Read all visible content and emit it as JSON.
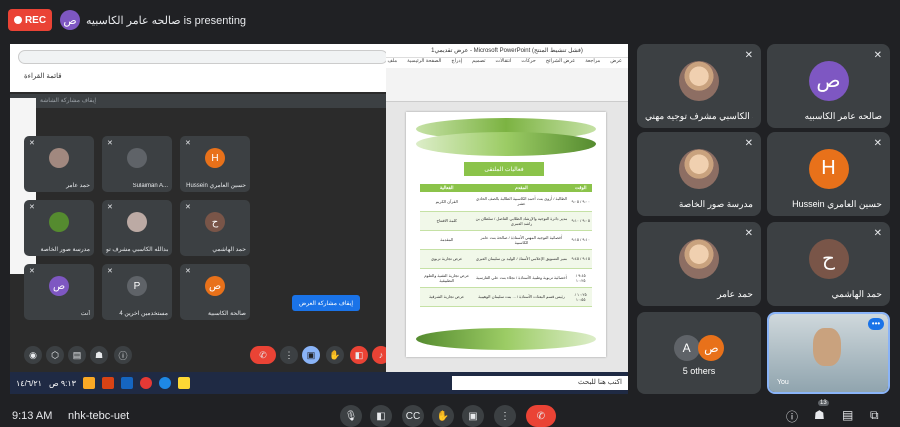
{
  "top": {
    "rec_label": "REC",
    "presenter_initial": "ص",
    "presenting_text": "صالحه عامر الكاسبيه is presenting"
  },
  "shared_screen": {
    "bookmarks_label": "قائمة القراءة",
    "share_strip_text": "إيقاف مشاركة الشاشة",
    "mini_tiles": [
      {
        "label": "Sulaiman A...",
        "initial": "",
        "color": "#5f6368"
      },
      {
        "label": "Hussein حسين العامري",
        "initial": "H",
        "color": "#e8711a"
      },
      {
        "label": "حمد عامر",
        "initial": "",
        "color": "#a1887f"
      },
      {
        "label": "عبدالله الكاسبي مشرف تو...",
        "initial": "",
        "color": "#bcaaa4"
      },
      {
        "label": "حمد الهاشمي",
        "initial": "ح",
        "color": "#795548"
      },
      {
        "label": "مدرسة صور الخاصة",
        "initial": "",
        "color": "#558b2f"
      },
      {
        "label": "أنت",
        "initial": "ص",
        "color": "#7e57c2"
      },
      {
        "label": "4 مستخدمين آخرين",
        "initial": "P",
        "color": "#5f6368"
      },
      {
        "label": "صالحة الكاسبية",
        "initial": "ص",
        "color": "#e8711a"
      }
    ],
    "stop_share_label": "إيقاف مشاركة العرض",
    "taskbar_search": "اكتب هنا للبحث",
    "taskbar_time": "٩:١٣ ص",
    "taskbar_date": "١٤/٦/٢١"
  },
  "ppt": {
    "title": "عرض تقديمي1 - Microsoft PowerPoint (فشل تنشيط المنتج)",
    "tabs": [
      "ملف",
      "الصفحة الرئيسية",
      "إدراج",
      "تصميم",
      "انتقالات",
      "حركات",
      "عرض الشرائح",
      "مراجعة",
      "عرض"
    ],
    "slide_title": "فعاليات الملتقى",
    "table_headers": [
      "الفعالية",
      "المقدم",
      "الوقت"
    ],
    "table_rows": [
      [
        "القرآن الكريم",
        "الطالبة / أروى بنت أحمد الكاسبية الطالبة بالصف الحادي عشر",
        "٩:٠٠ / ٩:٠٥"
      ],
      [
        "كلمة الافتتاح",
        "مدير دائرة التوجيه والإرشاد الطلابي الفاضل / سلطان بن راشد العمري",
        "٩:٠٥ / ٩:١٠"
      ],
      [
        "المقدمة",
        "أخصائية التوجيه المهني الأستاذة / صالحة بنت عامر الكاسبية",
        "٩:١٠ / ٩:١٥"
      ],
      [
        "عرض تجاربة تربوي",
        "منير التسويق الإعلامي الأستاذ / الوليد بن سليمان العبري",
        "٩:١٥ / ٩:٤٥"
      ],
      [
        "عرض تجاربة التقنية والعلوم التطبيقية",
        "أخصائية تربوية وطبية الأستاذة / نجلاء بنت علي الفارسية",
        "٩:٤٥ / ١٠:٢٥"
      ],
      [
        "عرض تجاربة الشرقية",
        "رئيس قسم البعثات الأستاذة / ... بنت سليمان الوهيبية",
        "١٠:٢٥ / ١٠:٥٥"
      ]
    ]
  },
  "tiles": [
    {
      "name": "صالحه عامر الكاسبيه",
      "initial": "ص",
      "color": "#7e57c2",
      "photo": false
    },
    {
      "name": "عبدالله الكاسبي مشرف توجيه مهني",
      "initial": "",
      "color": "",
      "photo": true
    },
    {
      "name": "Hussein حسين العامري",
      "initial": "H",
      "color": "#e8711a",
      "photo": false
    },
    {
      "name": "مدرسة صور الخاصة",
      "initial": "",
      "color": "",
      "photo": true
    },
    {
      "name": "حمد الهاشمي",
      "initial": "ح",
      "color": "#795548",
      "photo": false
    },
    {
      "name": "حمد عامر",
      "initial": "",
      "color": "",
      "photo": true
    },
    {
      "name": "You",
      "initial": "",
      "color": "",
      "photo": true
    },
    {
      "name": "5 others",
      "initial": "",
      "color": "",
      "photo": false
    }
  ],
  "others": {
    "a": "A",
    "b": "ص"
  },
  "bottom": {
    "time": "9:13 AM",
    "meeting_code": "nhk-tebc-uet",
    "participants_count": "13"
  }
}
